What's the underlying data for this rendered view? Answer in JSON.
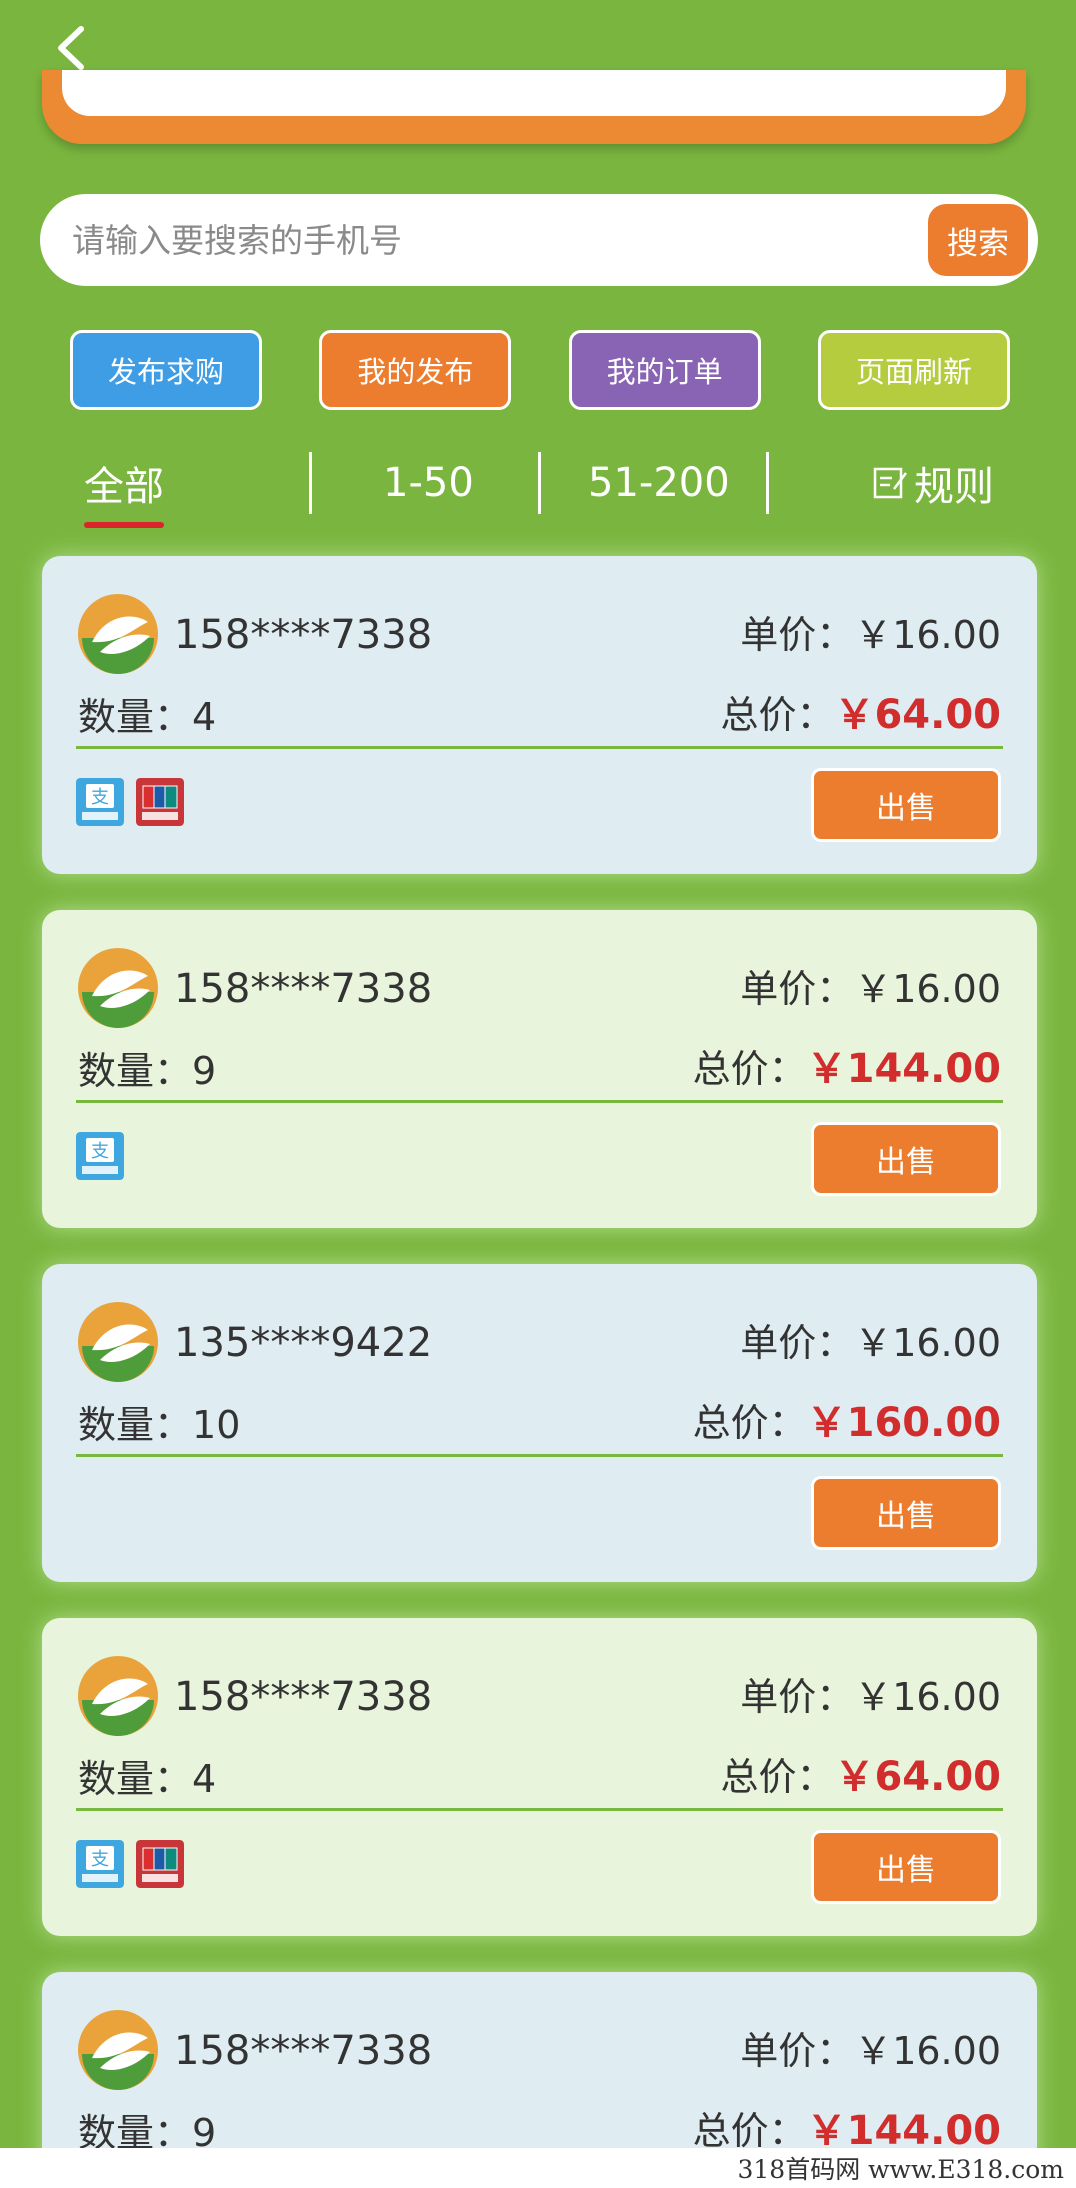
{
  "search": {
    "placeholder": "请输入要搜索的手机号",
    "button_label": "搜索"
  },
  "actions": [
    {
      "label": "发布求购",
      "color": "#3f9de5"
    },
    {
      "label": "我的发布",
      "color": "#ec7d2e"
    },
    {
      "label": "我的订单",
      "color": "#8a64b4"
    },
    {
      "label": "页面刷新",
      "color": "#b5cc3e"
    }
  ],
  "filters": {
    "tabs": [
      "全部",
      "1-50",
      "51-200"
    ],
    "active_index": 0,
    "rules_label": "规则"
  },
  "card_labels": {
    "unit_price": "单价：",
    "total_price": "总价：",
    "quantity": "数量：",
    "sell": "出售"
  },
  "listings": [
    {
      "phone": "158****7338",
      "unit_price": "￥16.00",
      "quantity": "4",
      "total_price": "￥64.00",
      "pay_methods": [
        "alipay-icon",
        "unionpay-icon"
      ]
    },
    {
      "phone": "158****7338",
      "unit_price": "￥16.00",
      "quantity": "9",
      "total_price": "￥144.00",
      "pay_methods": [
        "alipay-icon"
      ]
    },
    {
      "phone": "135****9422",
      "unit_price": "￥16.00",
      "quantity": "10",
      "total_price": "￥160.00",
      "pay_methods": []
    },
    {
      "phone": "158****7338",
      "unit_price": "￥16.00",
      "quantity": "4",
      "total_price": "￥64.00",
      "pay_methods": [
        "alipay-icon",
        "unionpay-icon"
      ]
    },
    {
      "phone": "158****7338",
      "unit_price": "￥16.00",
      "quantity": "9",
      "total_price": "￥144.00",
      "pay_methods": []
    }
  ],
  "watermark": "318首码网  www.E318.com",
  "colors": {
    "background": "#7ab63f",
    "accent": "#ec7d2e",
    "price_red": "#d22d2d"
  }
}
